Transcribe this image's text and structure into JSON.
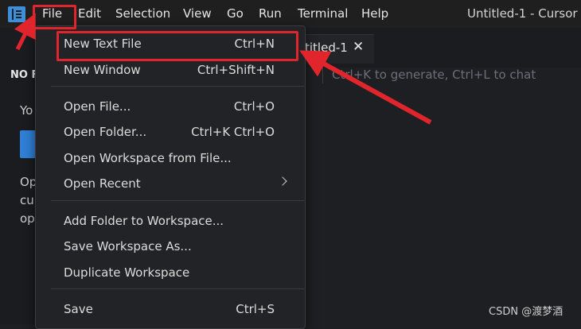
{
  "titlebar": {
    "menu": [
      "File",
      "Edit",
      "Selection",
      "View",
      "Go",
      "Run",
      "Terminal",
      "Help"
    ],
    "window_title": "Untitled-1 - Cursor"
  },
  "sidebar": {
    "title": "NO F",
    "line1": "Yo",
    "text_lines": [
      "Op",
      "cu",
      "op"
    ]
  },
  "editor": {
    "tab_label": "titled-1",
    "tab_close": "✕",
    "hint": "Ctrl+K to generate, Ctrl+L to chat"
  },
  "file_menu": {
    "items": [
      {
        "label": "New Text File",
        "shortcut": "Ctrl+N"
      },
      {
        "label": "New Window",
        "shortcut": "Ctrl+Shift+N"
      },
      {
        "label": "Open File...",
        "shortcut": "Ctrl+O"
      },
      {
        "label": "Open Folder...",
        "shortcut": "Ctrl+K Ctrl+O"
      },
      {
        "label": "Open Workspace from File...",
        "shortcut": ""
      },
      {
        "label": "Open Recent",
        "shortcut": ""
      },
      {
        "label": "Add Folder to Workspace...",
        "shortcut": ""
      },
      {
        "label": "Save Workspace As...",
        "shortcut": ""
      },
      {
        "label": "Duplicate Workspace",
        "shortcut": ""
      },
      {
        "label": "Save",
        "shortcut": "Ctrl+S"
      }
    ]
  },
  "annotation": {
    "color": "#e0262c"
  },
  "watermark": "CSDN @渡梦酒"
}
